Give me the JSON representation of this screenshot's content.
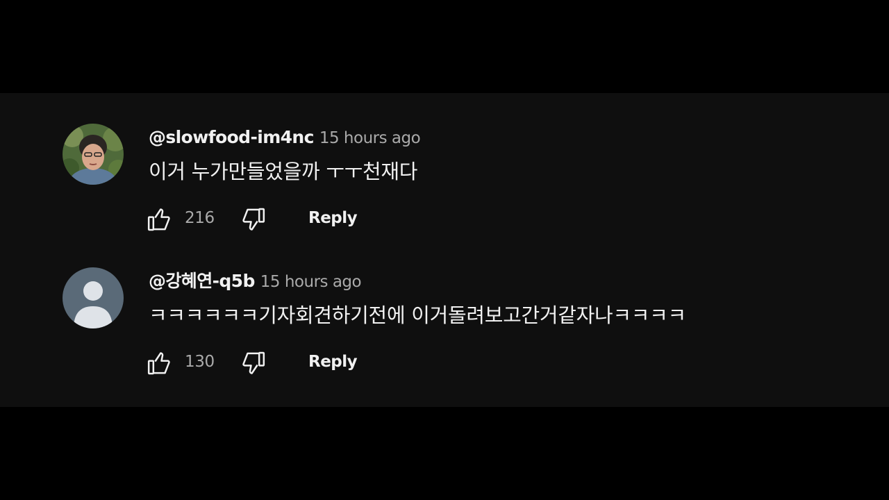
{
  "comments": [
    {
      "author": "@slowfood-im4nc",
      "time": "15 hours ago",
      "text": "이거 누가만들었을까 ㅜㅜ천재다",
      "likes": "216",
      "reply_label": "Reply",
      "avatar": "user-photo"
    },
    {
      "author": "@강혜연-q5b",
      "time": "15 hours ago",
      "text": "ㅋㅋㅋㅋㅋㅋ기자회견하기전에 이거돌려보고간거같자나ㅋㅋㅋㅋ",
      "likes": "130",
      "reply_label": "Reply",
      "avatar": "default-person-icon"
    }
  ],
  "icons": {
    "like": "thumbs-up-icon",
    "dislike": "thumbs-down-icon"
  },
  "colors": {
    "background": "#0f0f0f",
    "letterbox": "#000000",
    "primary_text": "#f1f1f1",
    "secondary_text": "#aaaaaa",
    "default_avatar": "#5a6a78"
  }
}
